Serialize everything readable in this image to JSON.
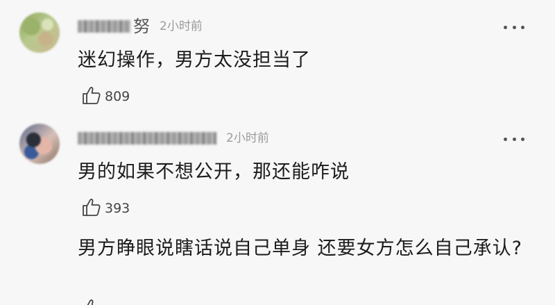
{
  "comments": [
    {
      "username_tail": "努",
      "time": "2小时前",
      "text": "迷幻操作，男方太没担当了",
      "likes": "809",
      "avatar_icon": "avatar-image"
    },
    {
      "username_tail": "",
      "time": "2小时前",
      "text": "男的如果不想公开，那还能咋说",
      "likes": "393",
      "avatar_icon": "avatar-image"
    },
    {
      "text": "男方睁眼说瞎话说自己单身 还要女方怎么自己承认?"
    }
  ],
  "icons": {
    "more": "more-horizontal-icon",
    "like": "thumbs-up-icon"
  },
  "colors": {
    "background": "#f7f7f7",
    "text": "#1c1c1c",
    "meta": "#9a9a9a"
  }
}
